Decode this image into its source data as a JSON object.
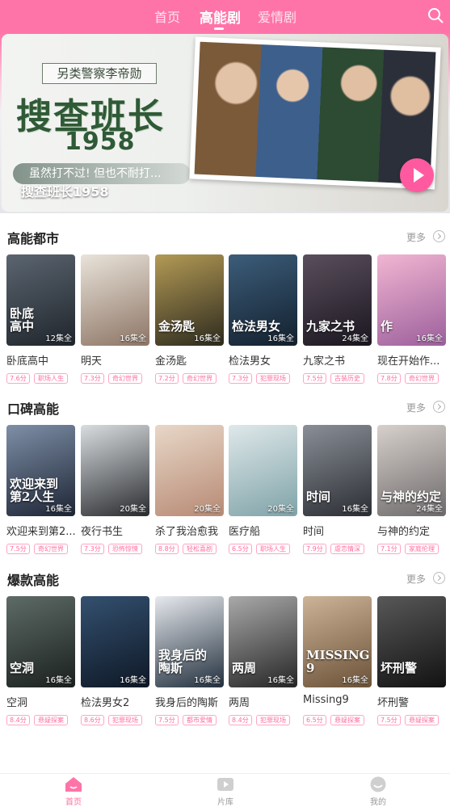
{
  "top_tabs": [
    {
      "label": "首页",
      "active": false
    },
    {
      "label": "高能剧",
      "active": true
    },
    {
      "label": "爱情剧",
      "active": false
    }
  ],
  "banner": {
    "subtitle": "另类警察李帝勋",
    "title": "搜查班长",
    "year": "1958",
    "tagline": "虽然打不过! 但也不耐打...",
    "caption": "搜查班长1958"
  },
  "more_label": "更多",
  "sections": [
    {
      "title": "高能都市",
      "items": [
        {
          "title": "卧底高中",
          "episodes": "12集全",
          "score": "7.6分",
          "genre": "职场人生",
          "poster_text": "卧底\n高中",
          "colors": [
            "#5b6570",
            "#1f252c"
          ]
        },
        {
          "title": "明天",
          "episodes": "16集全",
          "score": "7.3分",
          "genre": "奇幻世界",
          "poster_text": "",
          "colors": [
            "#e9e3da",
            "#8d7565"
          ]
        },
        {
          "title": "金汤匙",
          "episodes": "16集全",
          "score": "7.2分",
          "genre": "奇幻世界",
          "poster_text": "金汤匙",
          "colors": [
            "#b39a55",
            "#2d2a1e"
          ]
        },
        {
          "title": "检法男女",
          "episodes": "16集全",
          "score": "7.3分",
          "genre": "犯罪现场",
          "poster_text": "检法男女",
          "colors": [
            "#3c5d7a",
            "#13202e"
          ]
        },
        {
          "title": "九家之书",
          "episodes": "24集全",
          "score": "7.5分",
          "genre": "古装历史",
          "poster_text": "九家之书",
          "colors": [
            "#5a4f5c",
            "#1a1620"
          ]
        },
        {
          "title": "现在开始作...",
          "episodes": "16集全",
          "score": "7.8分",
          "genre": "奇幻世界",
          "poster_text": "作",
          "colors": [
            "#f1b6d2",
            "#9c5f9c"
          ]
        }
      ]
    },
    {
      "title": "口碑高能",
      "items": [
        {
          "title": "欢迎来到第2...",
          "episodes": "16集全",
          "score": "7.5分",
          "genre": "奇幻世界",
          "poster_text": "欢迎来到\n第2人生",
          "colors": [
            "#7e8fa7",
            "#1d2535"
          ]
        },
        {
          "title": "夜行书生",
          "episodes": "20集全",
          "score": "7.3分",
          "genre": "恐怖惊悚",
          "poster_text": "",
          "colors": [
            "#d9dde0",
            "#2a2c30"
          ]
        },
        {
          "title": "杀了我治愈我",
          "episodes": "20集全",
          "score": "8.8分",
          "genre": "轻松喜剧",
          "poster_text": "",
          "colors": [
            "#e8d7c8",
            "#b78a74"
          ]
        },
        {
          "title": "医疗船",
          "episodes": "20集全",
          "score": "6.5分",
          "genre": "职场人生",
          "poster_text": "",
          "colors": [
            "#dfe8ea",
            "#7fa3a8"
          ]
        },
        {
          "title": "时间",
          "episodes": "16集全",
          "score": "7.9分",
          "genre": "虐恋情深",
          "poster_text": "时间",
          "colors": [
            "#8a8e96",
            "#2b2e34"
          ]
        },
        {
          "title": "与神的约定",
          "episodes": "24集全",
          "score": "7.1分",
          "genre": "家庭伦理",
          "poster_text": "与神的约定",
          "colors": [
            "#d7d0cc",
            "#6e6a6b"
          ]
        }
      ]
    },
    {
      "title": "爆款高能",
      "items": [
        {
          "title": "空洞",
          "episodes": "16集全",
          "score": "8.4分",
          "genre": "悬疑探案",
          "poster_text": "空洞",
          "colors": [
            "#5e6b67",
            "#1a201e"
          ]
        },
        {
          "title": "检法男女2",
          "episodes": "16集全",
          "score": "8.6分",
          "genre": "犯罪现场",
          "poster_text": "",
          "colors": [
            "#34506f",
            "#0e1826"
          ]
        },
        {
          "title": "我身后的陶斯",
          "episodes": "16集全",
          "score": "7.5分",
          "genre": "都市爱情",
          "poster_text": "我身后的\n陶斯",
          "colors": [
            "#e7e9ee",
            "#22303e"
          ]
        },
        {
          "title": "两周",
          "episodes": "16集全",
          "score": "8.4分",
          "genre": "犯罪现场",
          "poster_text": "两周",
          "colors": [
            "#a9a9a9",
            "#262626"
          ]
        },
        {
          "title": "Missing9",
          "episodes": "16集全",
          "score": "6.5分",
          "genre": "悬疑探案",
          "poster_text": "MISSING\n9",
          "colors": [
            "#cdb397",
            "#6b5238"
          ]
        },
        {
          "title": "坏刑警",
          "episodes": "",
          "score": "7.5分",
          "genre": "悬疑探案",
          "poster_text": "坏刑警",
          "colors": [
            "#585858",
            "#121212"
          ]
        }
      ]
    }
  ],
  "bottom_nav": [
    {
      "label": "首页",
      "icon": "home-icon",
      "active": true
    },
    {
      "label": "片库",
      "icon": "video-library-icon",
      "active": false
    },
    {
      "label": "我的",
      "icon": "profile-icon",
      "active": false
    }
  ],
  "colors": {
    "accent": "#ff74a8",
    "tag": "#ff6e9f"
  }
}
